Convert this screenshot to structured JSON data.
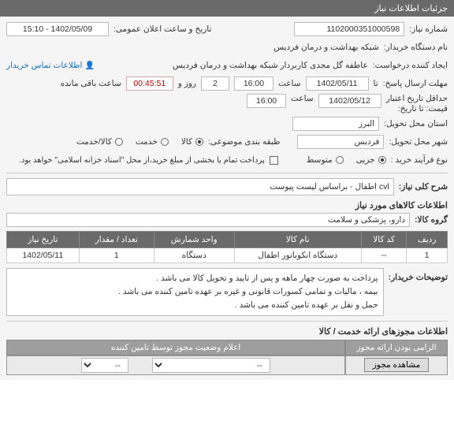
{
  "header": {
    "title": "جزئیات اطلاعات نیاز"
  },
  "labels": {
    "need_no": "شماره نیاز:",
    "public_announce": "تاریخ و ساعت اعلان عمومی:",
    "buyer_device": "نام دستگاه خریدار:",
    "request_creator": "ایجاد کننده درخواست:",
    "contact_btn": "اطلاعات تماس خریدار",
    "reply_deadline": "مهلت ارسال پاسخ:",
    "until": "تا",
    "hour": "ساعت",
    "days_and": "روز و",
    "time_left": "ساعت باقی مانده",
    "credit_min": "حداقل تاریخ اعتبار",
    "price_until": "قیمت: تا تاریخ:",
    "origin_province": "استان محل تحویل:",
    "origin_city": "شهر محل تحویل:",
    "subject_class": "طبقه بندی موضوعی:",
    "goods_opt": "کالا",
    "service_opt": "خدمت",
    "goods_service_opt": "کالا/خدمت",
    "purchase_process": "نوع فرآیند خرید :",
    "small_opt": "جزیی",
    "medium_opt": "متوسط",
    "islamic_note": "پرداخت تمام یا بخشی از مبلغ خرید،از محل \"اسناد خزانه اسلامی\" خواهد بود.",
    "need_summary": "شرح کلی نیاز:",
    "goods_info": "اطلاعات کالاهای مورد نیاز",
    "goods_group": "گروه کالا:",
    "buyer_notes": "توضیحات خریدار:",
    "permits_info": "اطلاعات مجوزهای ارائه خدمت / کالا",
    "permit_mandatory": "الزامی بودن ارائه مجوز",
    "permit_status": "اعلام وضعیت مجوز توسط تامین کننده",
    "view_permit_btn": "مشاهده مجوز"
  },
  "values": {
    "need_no": "1102000351000598",
    "public_announce": "1402/05/09 - 15:10",
    "buyer_device": "شبکه بهداشت و درمان فردیس",
    "request_creator": "عاطفه گل مجدی کاربردار شبکه بهداشت و درمان فردیس",
    "reply_date": "1402/05/11",
    "reply_time": "16:00",
    "days": "2",
    "countdown": "00:45:51",
    "credit_date": "1402/05/12",
    "credit_time": "16:00",
    "province": "البرز",
    "city": "فردیس",
    "need_summary": "cvl اطفال - براساس لیست پیوست",
    "goods_group": "دارو، پزشکی و سلامت",
    "buyer_notes_1": "پرداخت به صورت چهار ماهه و پس از تایید و تحویل کالا می باشد .",
    "buyer_notes_2": "بیمه ، مالیات و تمامی کسورات قانونی و غیره بر عهده تامین کننده می باشد .",
    "buyer_notes_3": "حمل و نقل بر عهده تامین کننده می باشد ."
  },
  "subject_selected": "goods",
  "process_selected": "small",
  "table": {
    "headers": {
      "row": "ردیف",
      "code": "کد کالا",
      "name": "نام کالا",
      "unit": "واحد شمارش",
      "qty": "تعداد / مقدار",
      "date": "تاریخ نیاز"
    },
    "rows": [
      {
        "row": "1",
        "code": "--",
        "name": "دستگاه انکوباتور اطفال",
        "unit": "دستگاه",
        "qty": "1",
        "date": "1402/05/11"
      }
    ]
  },
  "permit": {
    "status_sel": "--",
    "mandatory_sel": "--"
  }
}
